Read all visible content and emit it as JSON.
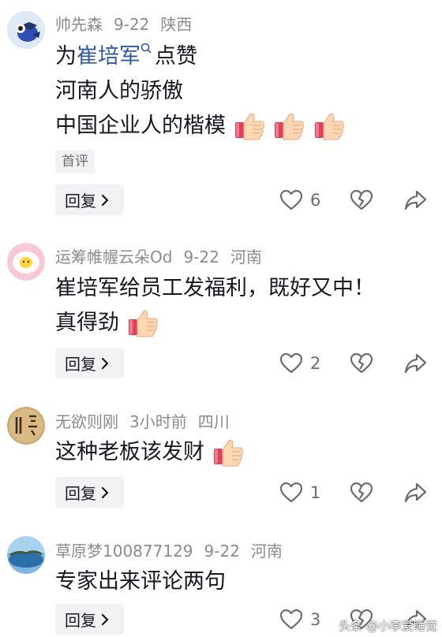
{
  "comments": [
    {
      "username": "帅先森",
      "date": "9-22",
      "location": "陕西",
      "text_prefix": "为",
      "mention": "崔培军",
      "text_suffix": "点赞",
      "line2": "河南人的骄傲",
      "line3": "中国企业人的楷模",
      "tag": "首评",
      "reply_label": "回复",
      "likes": "6"
    },
    {
      "username": "运筹帷幄云朵Od",
      "date": "9-22",
      "location": "河南",
      "line1": "崔培军给员工发福利，既好又中！",
      "line2": "真得劲",
      "reply_label": "回复",
      "likes": "2"
    },
    {
      "username": "无欲则刚",
      "date": "3小时前",
      "location": "四川",
      "line1": "这种老板该发财",
      "reply_label": "回复",
      "likes": "1"
    },
    {
      "username": "草原梦100877129",
      "date": "9-22",
      "location": "河南",
      "line1": "专家出来评论两句",
      "reply_label": "回复",
      "likes": "3"
    }
  ],
  "watermark": "头条 @小李爱睡觉",
  "colors": {
    "mention": "#2f5a9e",
    "meta": "#8a8b91",
    "button_bg": "#f2f2f4"
  },
  "icons": [
    "heart-icon",
    "broken-heart-icon",
    "share-icon",
    "thumbs-up-emoji",
    "chevron-right-icon",
    "search-icon"
  ]
}
